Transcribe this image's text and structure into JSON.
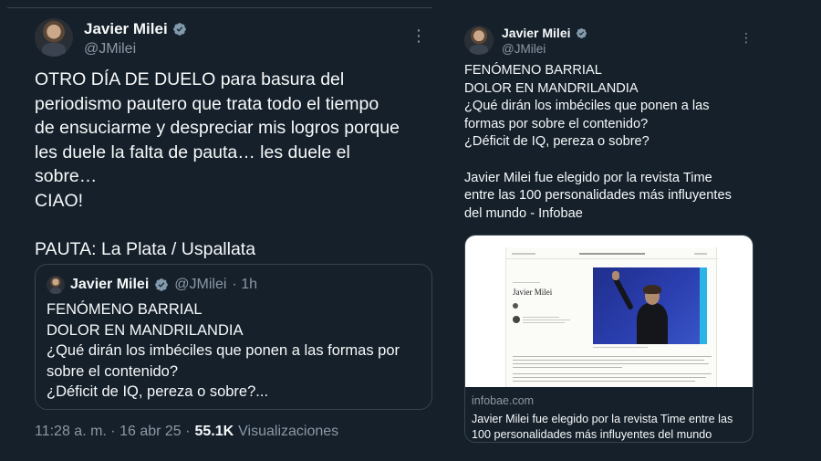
{
  "left_tweet": {
    "author_name": "Javier Milei",
    "author_handle": "@JMilei",
    "text": "OTRO DÍA DE DUELO para basura del\nperiodismo pautero que trata todo el tiempo\nde ensuciarme y despreciar mis logros porque\nles duele la falta de pauta… les duele el\nsobre…\nCIAO!\n\nPAUTA: La Plata / Uspallata",
    "quote": {
      "author_name": "Javier Milei",
      "author_handle": "@JMilei",
      "age": "· 1h",
      "text": "FENÓMENO BARRIAL\nDOLOR EN MANDRILANDIA\n¿Qué dirán los imbéciles que ponen a las formas por\nsobre el contenido?\n¿Déficit de IQ, pereza o sobre?..."
    },
    "timestamp": "11:28 a. m. · 16 abr 25 ·",
    "views_count": "55.1K",
    "views_label": "Visualizaciones"
  },
  "right_tweet": {
    "author_name": "Javier Milei",
    "author_handle": "@JMilei",
    "text": "FENÓMENO BARRIAL\nDOLOR EN MANDRILANDIA\n¿Qué dirán los imbéciles que ponen a las\nformas por sobre el contenido?\n¿Déficit de IQ, pereza o sobre?\n\nJavier Milei fue elegido por la revista Time\nentre las 100 personalidades más influyentes\ndel mundo - Infobae",
    "card": {
      "page_heading": "Javier Milei",
      "domain": "infobae.com",
      "title": "Javier Milei fue elegido por la revista Time entre las 100 personalidades más influyentes del mundo"
    }
  },
  "colors": {
    "background": "#15202b",
    "text": "#f7f9f9",
    "secondary_text": "#8b98a5",
    "border": "#38444d",
    "verified": "#829aab"
  },
  "icons": [
    "verified-badge-icon",
    "more-options-icon"
  ]
}
